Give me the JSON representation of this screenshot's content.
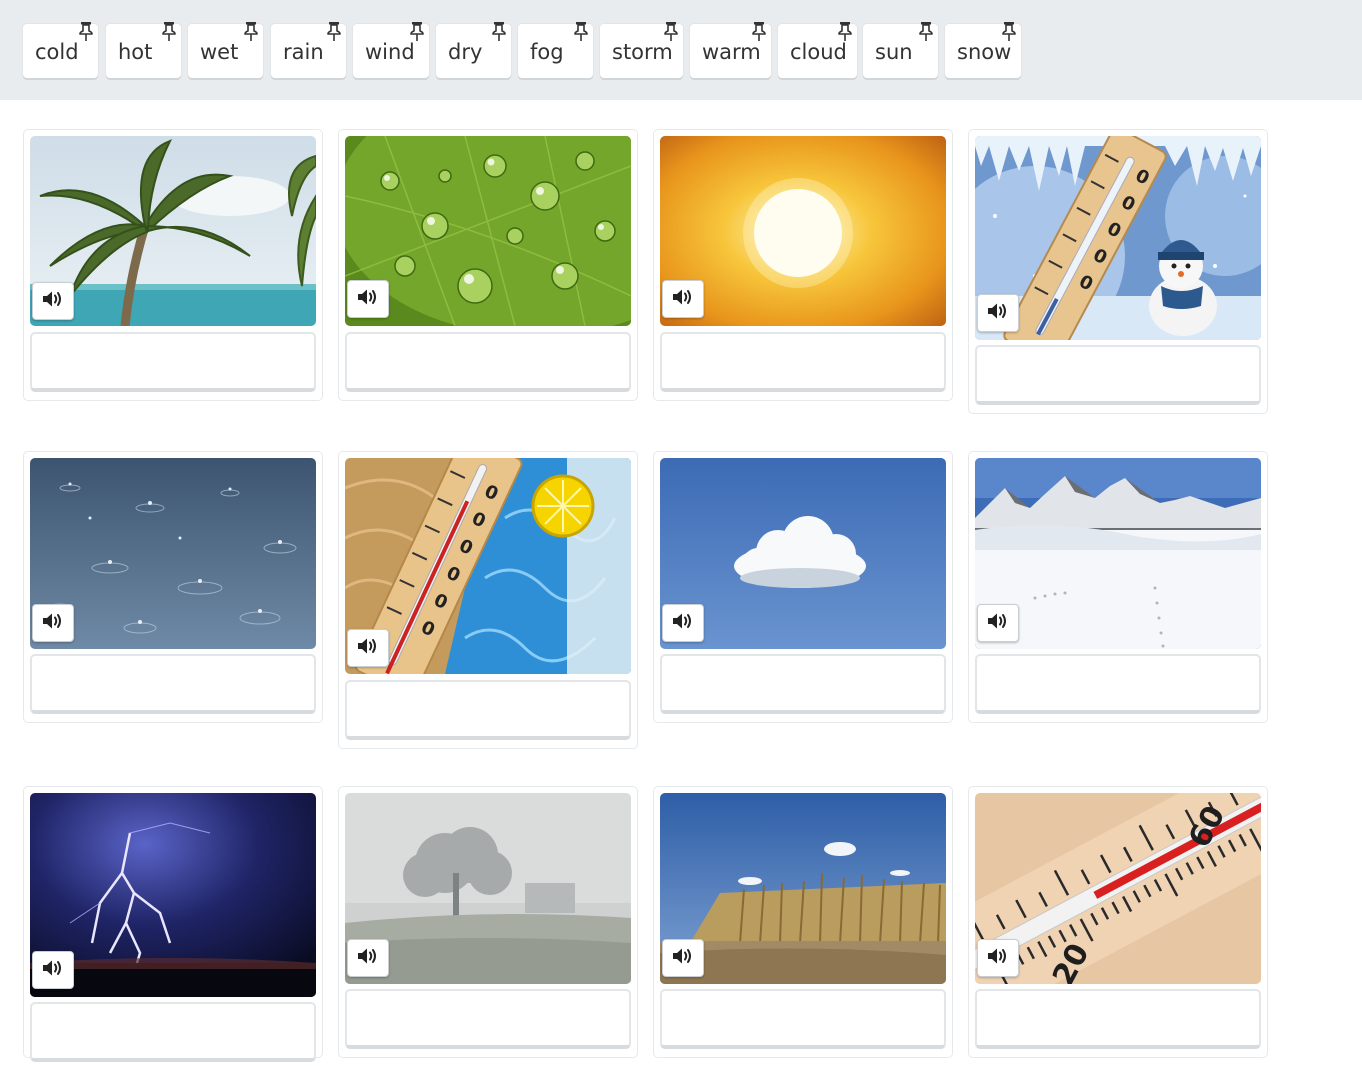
{
  "word_bank": {
    "words": [
      "cold",
      "hot",
      "wet",
      "rain",
      "wind",
      "dry",
      "fog",
      "storm",
      "warm",
      "cloud",
      "sun",
      "snow"
    ]
  },
  "cards": [
    {
      "image": "palm-tree-wind",
      "icon": "speaker-icon",
      "answer": ""
    },
    {
      "image": "water-drops-leaf",
      "icon": "speaker-icon",
      "answer": ""
    },
    {
      "image": "bright-sun",
      "icon": "speaker-icon",
      "answer": ""
    },
    {
      "image": "snowman-thermometer",
      "icon": "speaker-icon",
      "answer": ""
    },
    {
      "image": "raindrops-puddle",
      "icon": "speaker-icon",
      "answer": ""
    },
    {
      "image": "hot-thermometer-pool",
      "icon": "speaker-icon",
      "answer": ""
    },
    {
      "image": "single-cloud",
      "icon": "speaker-icon",
      "answer": ""
    },
    {
      "image": "snowy-mountains",
      "icon": "speaker-icon",
      "answer": ""
    },
    {
      "image": "lightning-storm",
      "icon": "speaker-icon",
      "answer": ""
    },
    {
      "image": "foggy-field",
      "icon": "speaker-icon",
      "answer": ""
    },
    {
      "image": "dry-cornfield",
      "icon": "speaker-icon",
      "answer": ""
    },
    {
      "image": "warm-thermometer",
      "icon": "speaker-icon",
      "answer": ""
    }
  ],
  "colors": {
    "wordbar_bg": "#e8ecee",
    "card_border": "#e6e9eb"
  }
}
